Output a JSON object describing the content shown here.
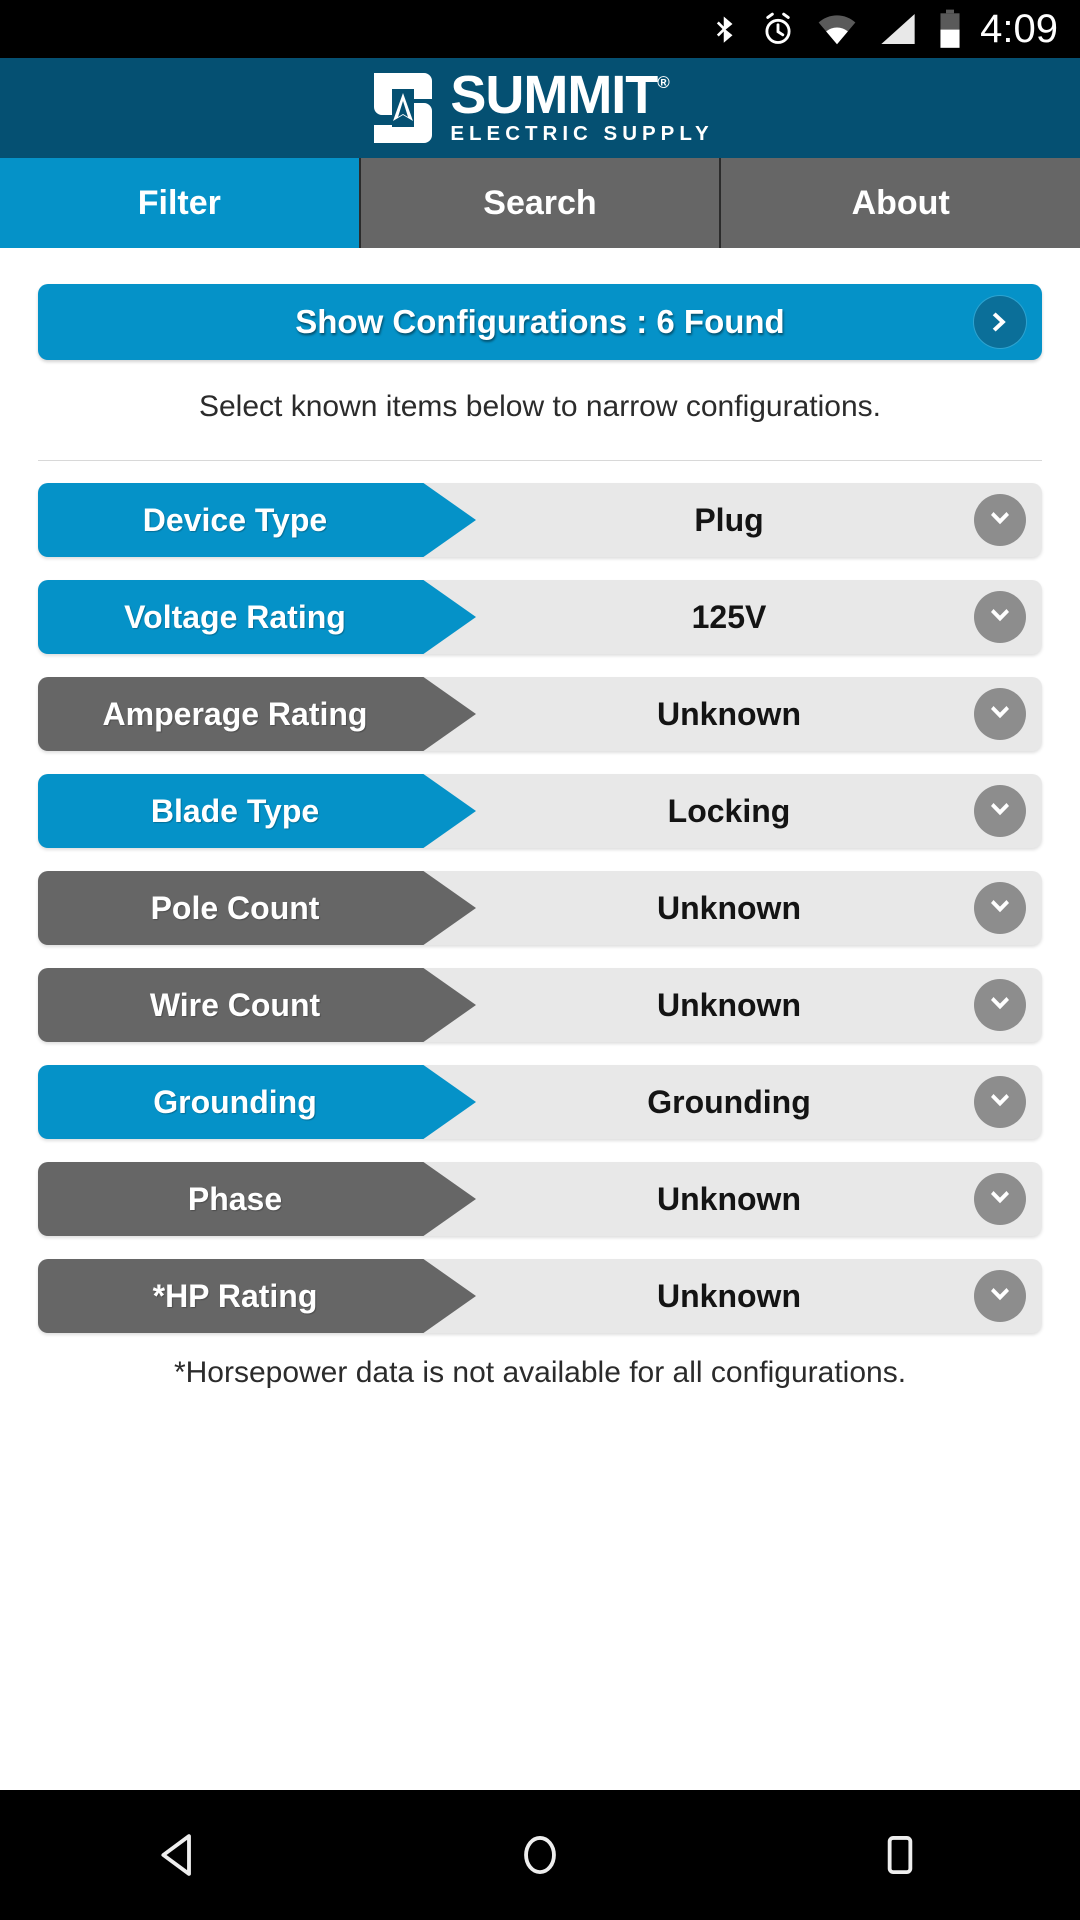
{
  "status_bar": {
    "time": "4:09",
    "icons": [
      "bluetooth-icon",
      "alarm-icon",
      "wifi-icon",
      "cellular-signal-icon",
      "battery-icon"
    ]
  },
  "brand": {
    "name": "SUMMIT",
    "registered_mark": "®",
    "tagline": "ELECTRIC SUPPLY",
    "bar_color": "#055072"
  },
  "tabs": [
    {
      "label": "Filter",
      "active": true
    },
    {
      "label": "Search",
      "active": false
    },
    {
      "label": "About",
      "active": false
    }
  ],
  "show_configurations": {
    "label": "Show Configurations : 6 Found",
    "count": 6,
    "arrow_icon": "chevron-right-icon"
  },
  "hint_text": "Select known items below to narrow configurations.",
  "footnote_text": "*Horsepower data is not available for all configurations.",
  "filters": [
    {
      "label": "Device Type",
      "value": "Plug",
      "selected": true,
      "chevron": "chevron-down-icon"
    },
    {
      "label": "Voltage Rating",
      "value": "125V",
      "selected": true,
      "chevron": "chevron-down-icon"
    },
    {
      "label": "Amperage Rating",
      "value": "Unknown",
      "selected": false,
      "chevron": "chevron-down-icon"
    },
    {
      "label": "Blade Type",
      "value": "Locking",
      "selected": true,
      "chevron": "chevron-down-icon"
    },
    {
      "label": "Pole Count",
      "value": "Unknown",
      "selected": false,
      "chevron": "chevron-down-icon"
    },
    {
      "label": "Wire Count",
      "value": "Unknown",
      "selected": false,
      "chevron": "chevron-down-icon"
    },
    {
      "label": "Grounding",
      "value": "Grounding",
      "selected": true,
      "chevron": "chevron-down-icon"
    },
    {
      "label": "Phase",
      "value": "Unknown",
      "selected": false,
      "chevron": "chevron-down-icon"
    },
    {
      "label": "*HP Rating",
      "value": "Unknown",
      "selected": false,
      "chevron": "chevron-down-icon"
    }
  ],
  "nav_bar": {
    "back": "back-triangle-icon",
    "home": "home-circle-icon",
    "recents": "recents-square-icon"
  },
  "colors": {
    "accent_blue": "#0592c8",
    "header_blue": "#055072",
    "inactive_gray": "#666666",
    "value_bg": "#e8e8e8",
    "chevron_bg": "#8d8d8d"
  }
}
